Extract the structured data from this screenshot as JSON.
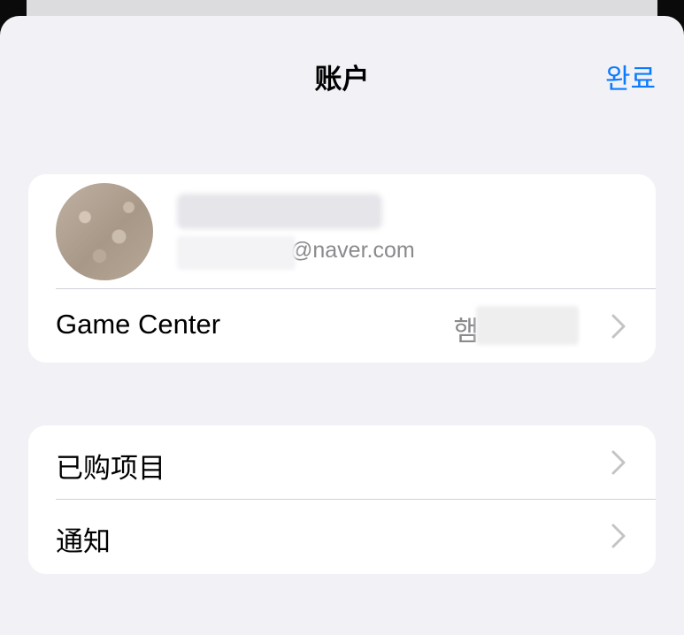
{
  "nav": {
    "title": "账户",
    "done_label": "완료"
  },
  "account": {
    "email_visible": "@naver.com"
  },
  "game_center": {
    "label": "Game Center",
    "value_visible": "햄"
  },
  "menu": {
    "items": [
      {
        "label": "已购项目"
      },
      {
        "label": "通知"
      }
    ]
  },
  "colors": {
    "accent": "#0a7aff",
    "background": "#f2f1f6",
    "card": "#ffffff",
    "secondary_text": "#8a8a8e",
    "separator": "#d1d1d6"
  },
  "icons": {
    "chevron": "chevron-right-icon",
    "avatar": "avatar"
  }
}
